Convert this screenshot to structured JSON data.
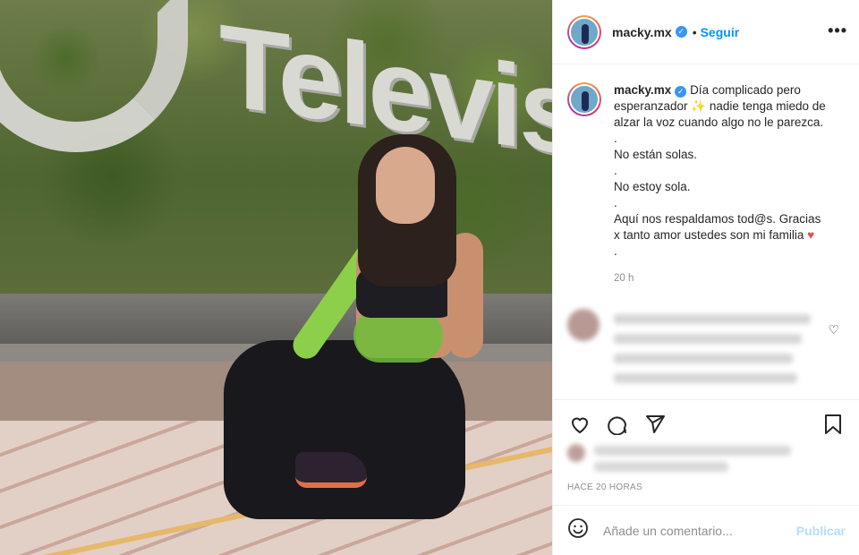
{
  "post": {
    "username": "macky.mx",
    "follow_label": "Seguir",
    "separator": "•",
    "more_label": "•••",
    "caption_lines": [
      "Día complicado pero",
      "esperanzador",
      "nadie tenga miedo de",
      "alzar la voz cuando algo no le parezca.",
      ".",
      "No están solas.",
      ".",
      "No estoy sola.",
      ".",
      "Aquí nos respaldamos tod@s. Gracias",
      "x tanto amor ustedes son mi familia",
      "."
    ],
    "caption_time": "20 h",
    "time_ago": "HACE 20 HORAS",
    "comment_placeholder": "Añade un comentario...",
    "publish_label": "Publicar"
  },
  "image": {
    "sign_text": "Televisa"
  },
  "icons": {
    "verified": "verified-badge",
    "like": "heart-icon",
    "comment": "comment-icon",
    "share": "share-icon",
    "save": "bookmark-icon",
    "emoji": "emoji-icon"
  },
  "colors": {
    "accent": "#0095f6",
    "publish_disabled": "#b2dffc",
    "muted": "#8e8e8e"
  }
}
